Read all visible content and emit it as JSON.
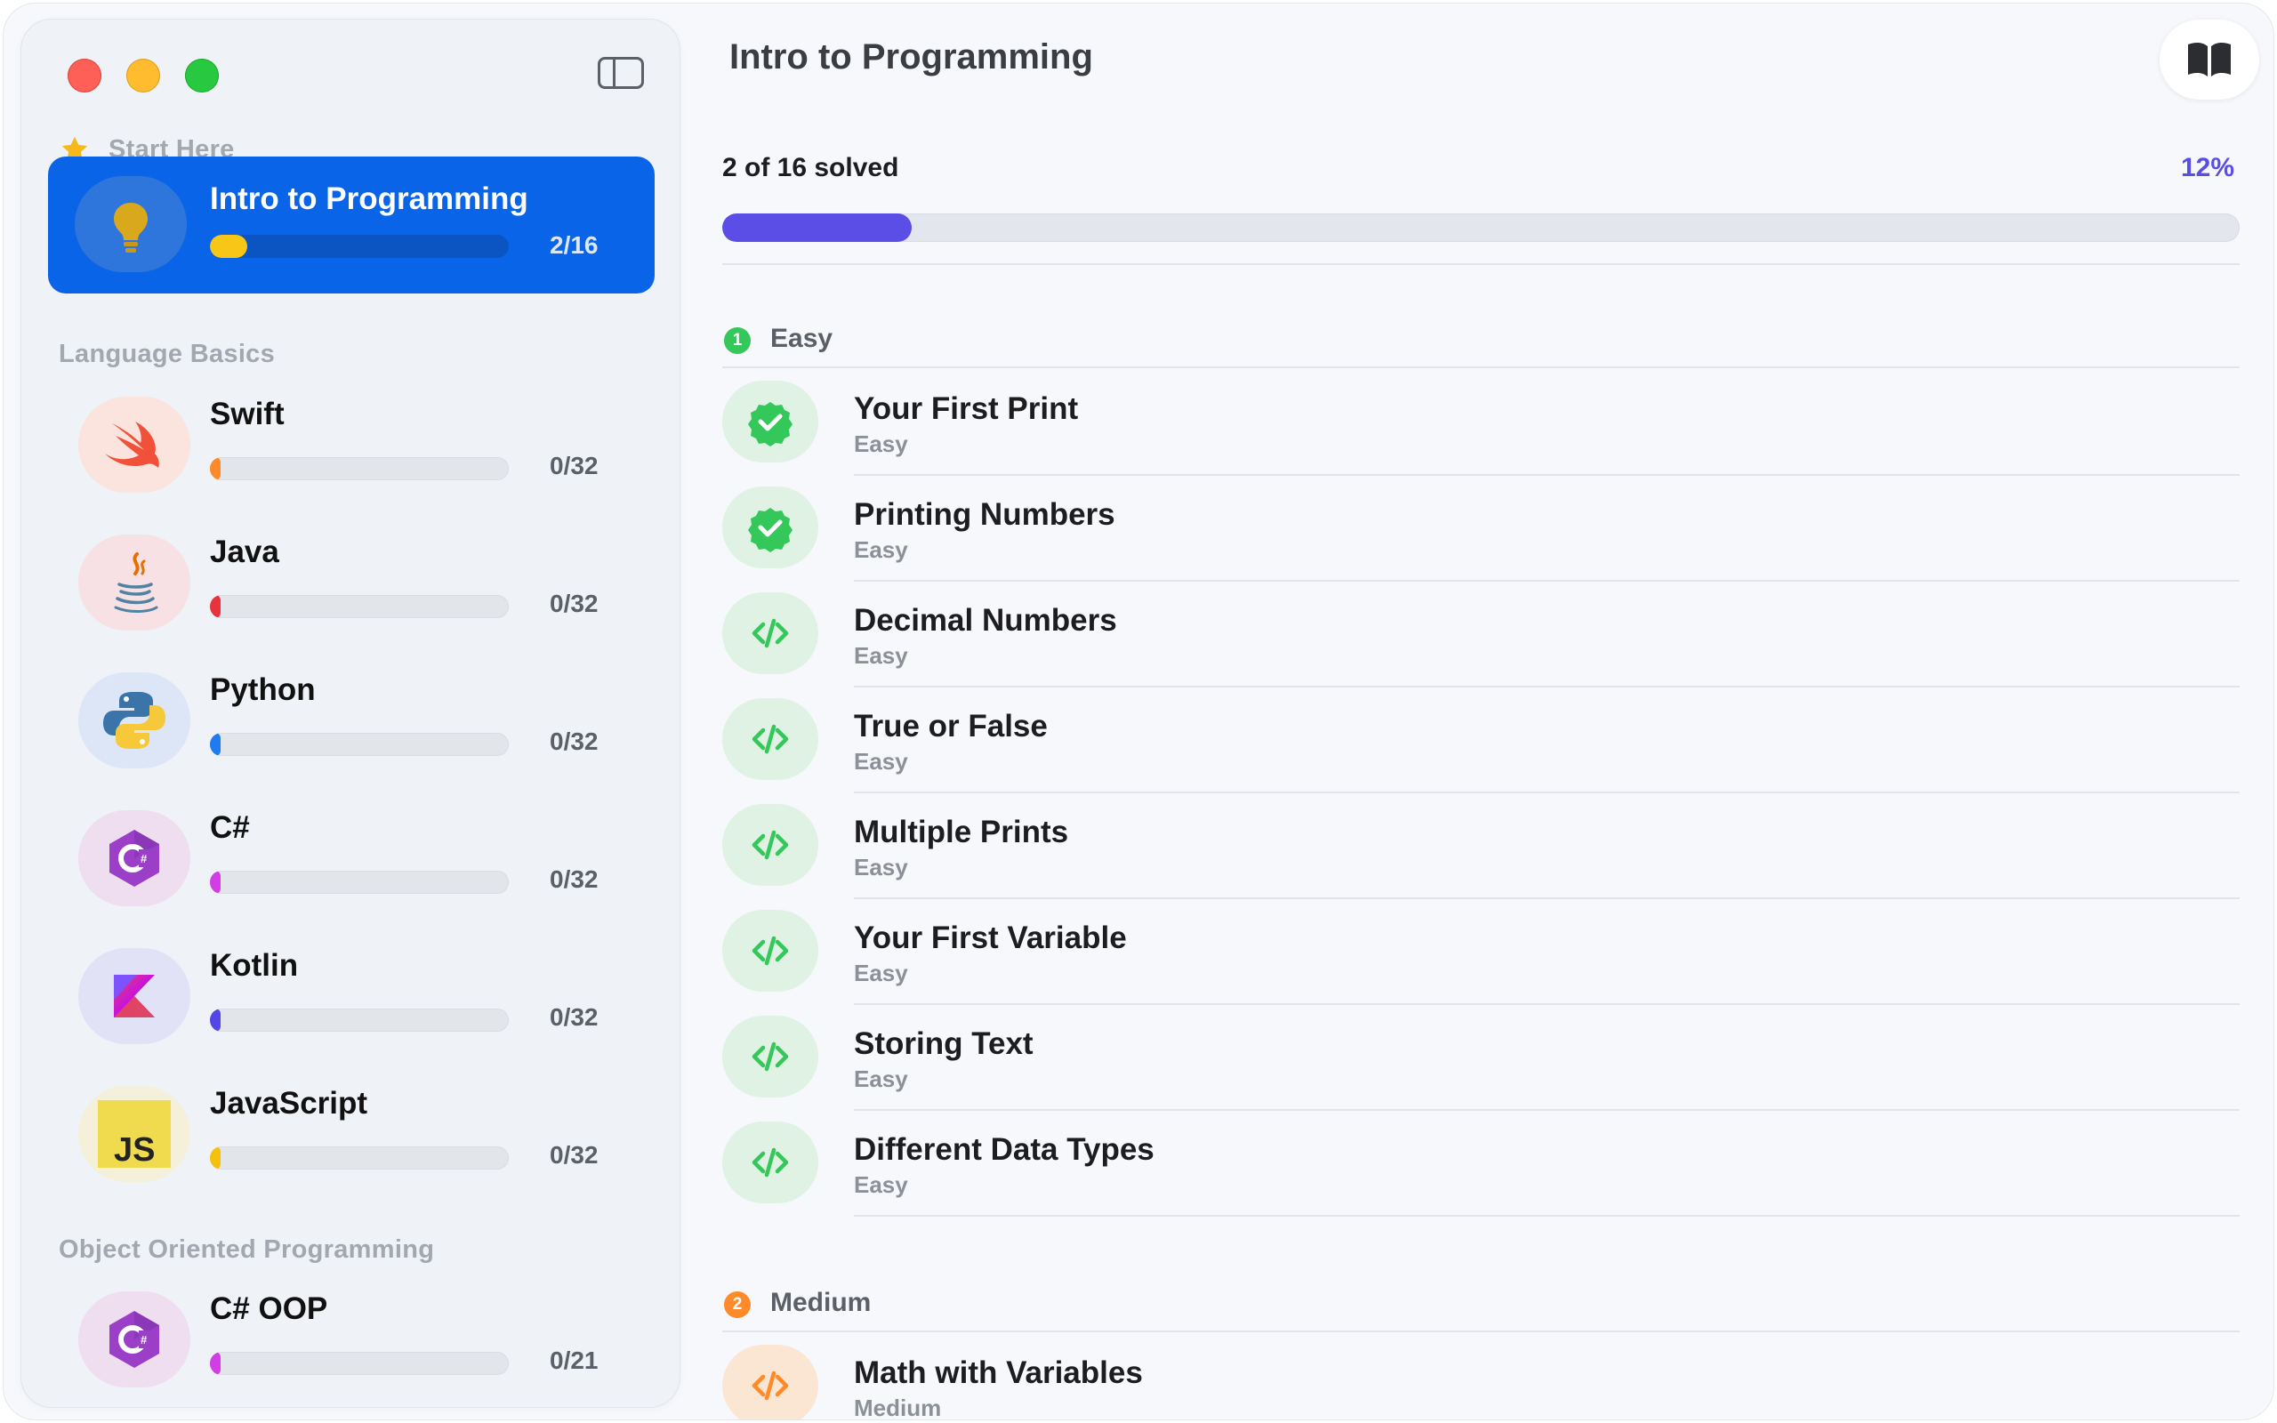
{
  "window": {
    "title": "Intro to Programming"
  },
  "sidebar": {
    "start_section": "Start Here",
    "featured": {
      "name": "Intro to Programming",
      "count": "2/16",
      "progress": 0.125,
      "accent": "#0a64e8"
    },
    "sections": [
      {
        "title": "Language Basics",
        "items": [
          {
            "name": "Swift",
            "count": "0/32",
            "icon": "swift-icon",
            "bar_color": "#ff8a2a"
          },
          {
            "name": "Java",
            "count": "0/32",
            "icon": "java-icon",
            "bar_color": "#e8323c"
          },
          {
            "name": "Python",
            "count": "0/32",
            "icon": "python-icon",
            "bar_color": "#1e7bf2"
          },
          {
            "name": "C#",
            "count": "0/32",
            "icon": "csharp-icon",
            "bar_color": "#d33de6"
          },
          {
            "name": "Kotlin",
            "count": "0/32",
            "icon": "kotlin-icon",
            "bar_color": "#5247e6"
          },
          {
            "name": "JavaScript",
            "count": "0/32",
            "icon": "javascript-icon",
            "bar_color": "#f4c20d"
          }
        ]
      },
      {
        "title": "Object Oriented Programming",
        "items": [
          {
            "name": "C# OOP",
            "count": "0/21",
            "icon": "csharp-icon",
            "bar_color": "#d33de6"
          }
        ]
      }
    ]
  },
  "main": {
    "title": "Intro to Programming",
    "progress_label": "2 of 16 solved",
    "progress_percent": "12%",
    "progress_value": 0.125,
    "progress_color": "#5b4ee6",
    "groups": [
      {
        "badge": "1",
        "label": "Easy",
        "color": "#34c759",
        "exercises": [
          {
            "title": "Your First Print",
            "difficulty": "Easy",
            "status": "solved"
          },
          {
            "title": "Printing Numbers",
            "difficulty": "Easy",
            "status": "solved"
          },
          {
            "title": "Decimal Numbers",
            "difficulty": "Easy",
            "status": "open"
          },
          {
            "title": "True or False",
            "difficulty": "Easy",
            "status": "open"
          },
          {
            "title": "Multiple Prints",
            "difficulty": "Easy",
            "status": "open"
          },
          {
            "title": "Your First Variable",
            "difficulty": "Easy",
            "status": "open"
          },
          {
            "title": "Storing Text",
            "difficulty": "Easy",
            "status": "open"
          },
          {
            "title": "Different Data Types",
            "difficulty": "Easy",
            "status": "open"
          }
        ]
      },
      {
        "badge": "2",
        "label": "Medium",
        "color": "#ff8a2a",
        "exercises": [
          {
            "title": "Math with Variables",
            "difficulty": "Medium",
            "status": "open"
          }
        ]
      }
    ]
  }
}
